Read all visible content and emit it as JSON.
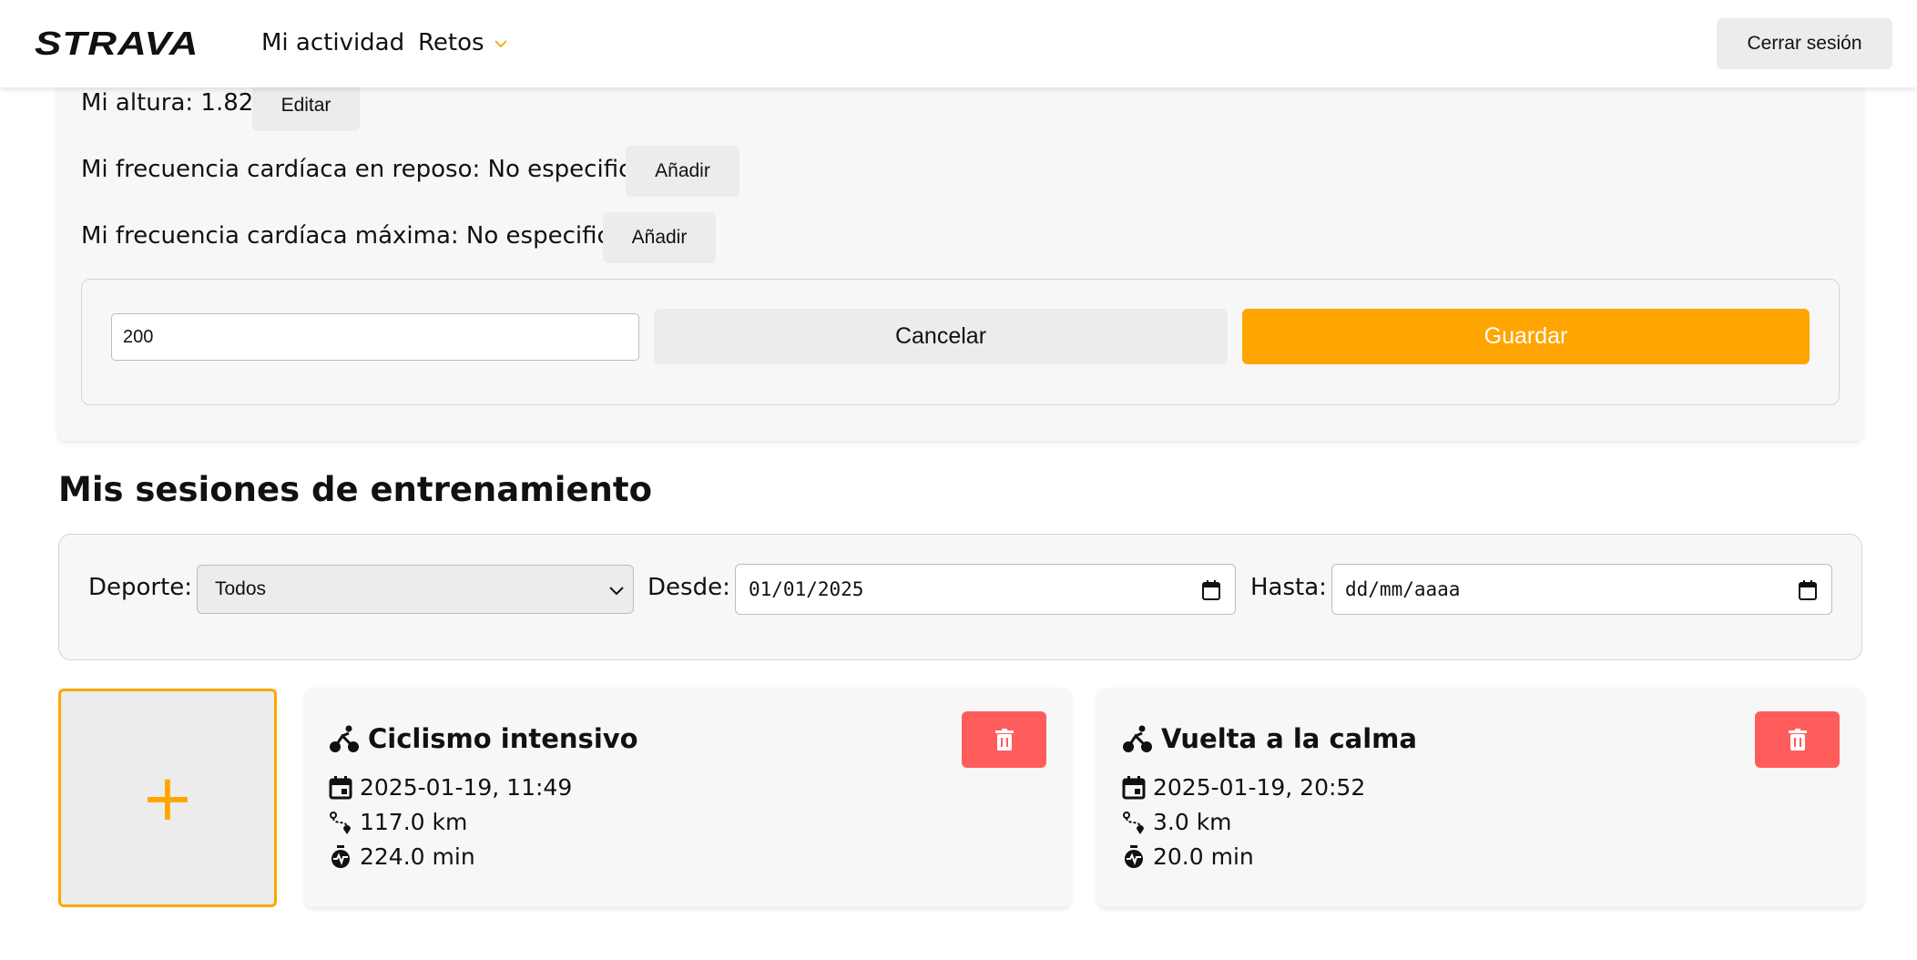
{
  "header": {
    "logo": "STRAVA",
    "nav": [
      {
        "label": "Mi actividad"
      },
      {
        "label": "Retos"
      }
    ],
    "logout_label": "Cerrar sesión"
  },
  "profile": {
    "height_text": "Mi altura: 1.82",
    "height_button": "Editar",
    "resting_hr_text": "Mi frecuencia cardíaca en reposo: No especificado",
    "resting_hr_button": "Añadir",
    "max_hr_text": "Mi frecuencia cardíaca máxima: No especificado",
    "max_hr_button": "Añadir",
    "edit_value": "200",
    "cancel_label": "Cancelar",
    "save_label": "Guardar"
  },
  "sessions": {
    "title": "Mis sesiones de entrenamiento",
    "filters": {
      "sport_label": "Deporte:",
      "sport_value": "Todos",
      "from_label": "Desde:",
      "from_value": "01/01/2025",
      "to_label": "Hasta:",
      "to_placeholder": "dd/mm/aaaa"
    },
    "add_symbol": "+",
    "items": [
      {
        "title": "Ciclismo intensivo",
        "datetime": "2025-01-19, 11:49",
        "distance": "117.0 km",
        "duration": "224.0 min"
      },
      {
        "title": "Vuelta a la calma",
        "datetime": "2025-01-19, 20:52",
        "distance": "3.0 km",
        "duration": "20.0 min"
      }
    ]
  },
  "colors": {
    "accent": "#ffa500",
    "danger": "#ff5c5c",
    "button_gray": "#ececec",
    "card_bg": "#f7f7f7"
  },
  "icons": {
    "sport": "bike-icon",
    "date": "calendar-icon",
    "distance": "route-icon",
    "duration": "timer-icon",
    "delete": "trash-icon"
  }
}
